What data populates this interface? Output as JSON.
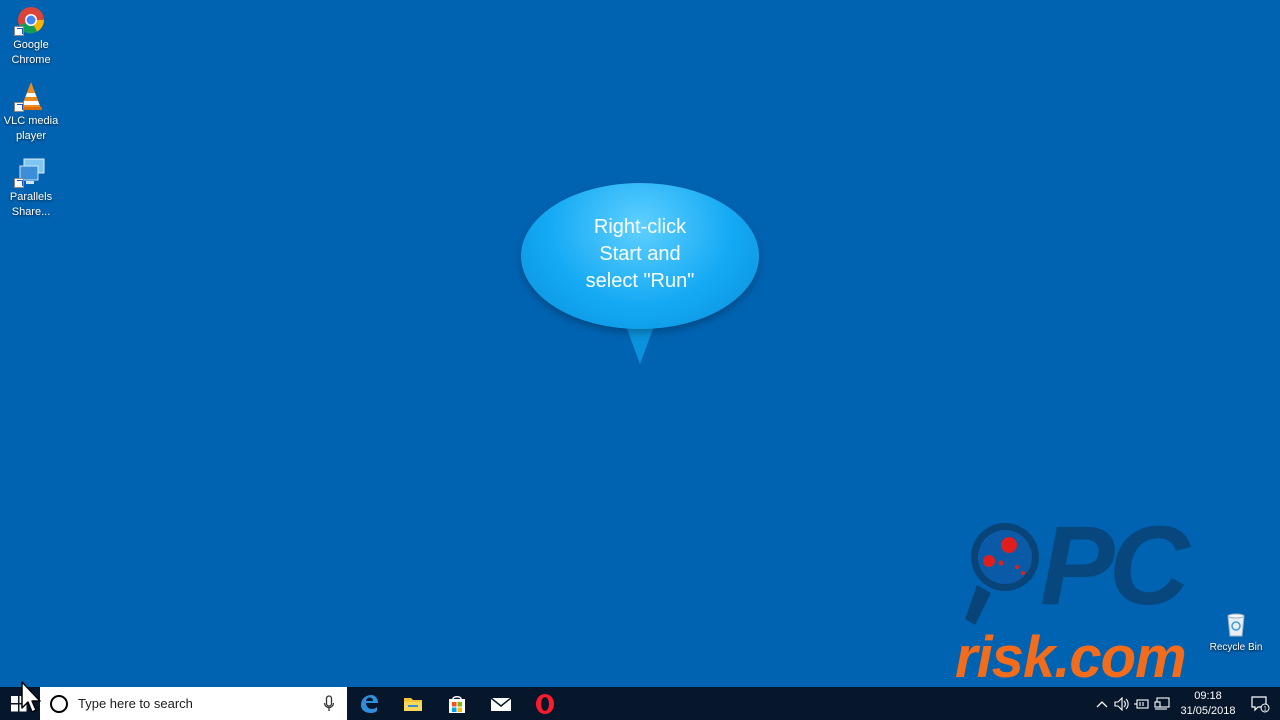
{
  "desktop": {
    "icons": [
      {
        "label_line1": "Google",
        "label_line2": "Chrome",
        "icon": "chrome-icon"
      },
      {
        "label_line1": "VLC media",
        "label_line2": "player",
        "icon": "vlc-icon"
      },
      {
        "label_line1": "Parallels",
        "label_line2": "Share...",
        "icon": "parallels-icon"
      }
    ],
    "recycle_bin_label": "Recycle Bin"
  },
  "callout": {
    "line1": "Right-click",
    "line2": "Start and",
    "line3": "select \"Run\""
  },
  "watermark": {
    "pc": "PC",
    "risk": "risk.com"
  },
  "taskbar": {
    "search_placeholder": "Type here to search",
    "apps": [
      "edge-icon",
      "file-explorer-icon",
      "store-icon",
      "mail-icon",
      "opera-icon"
    ],
    "clock_time": "09:18",
    "clock_date": "31/05/2018",
    "notification_count": "1"
  },
  "colors": {
    "desktop_bg": "#0063b1",
    "taskbar_bg": "#06162b",
    "callout": "#14a9f4",
    "watermark_orange": "#f26c1c"
  }
}
